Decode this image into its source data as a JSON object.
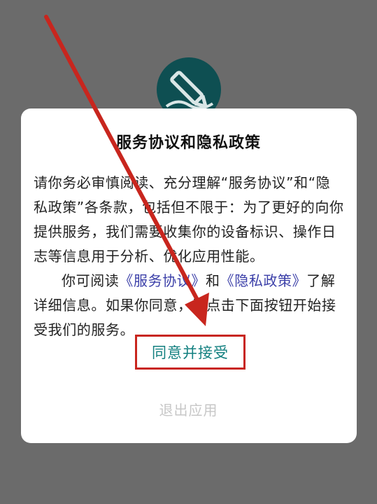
{
  "dialog": {
    "title": "服务协议和隐私政策",
    "paragraph1": "请你务必审慎阅读、充分理解“服务协议”和“隐私政策”各条款，包括但不限于：为了更好的向你提供服务，我们需要收集你的设备标识、操作日志等信息用于分析、优化应用性能。",
    "paragraph2_prefix": "你可阅读",
    "service_link": "《服务协议》",
    "paragraph2_and": "和",
    "privacy_link": "《隐私政策》",
    "paragraph2_suffix": "了解详细信息。如果你同意，请点击下面按钮开始接受我们的服务。",
    "agree_label": "同意并接受",
    "exit_label": "退出应用"
  },
  "colors": {
    "overlay": "#6b6b6b",
    "link": "#3b3fa8",
    "agree_text": "#138080",
    "highlight": "#c8261e",
    "exit_text": "#c7c7c7"
  },
  "icons": {
    "app_logo": "pencil-logo-icon",
    "annotation": "red-arrow"
  }
}
